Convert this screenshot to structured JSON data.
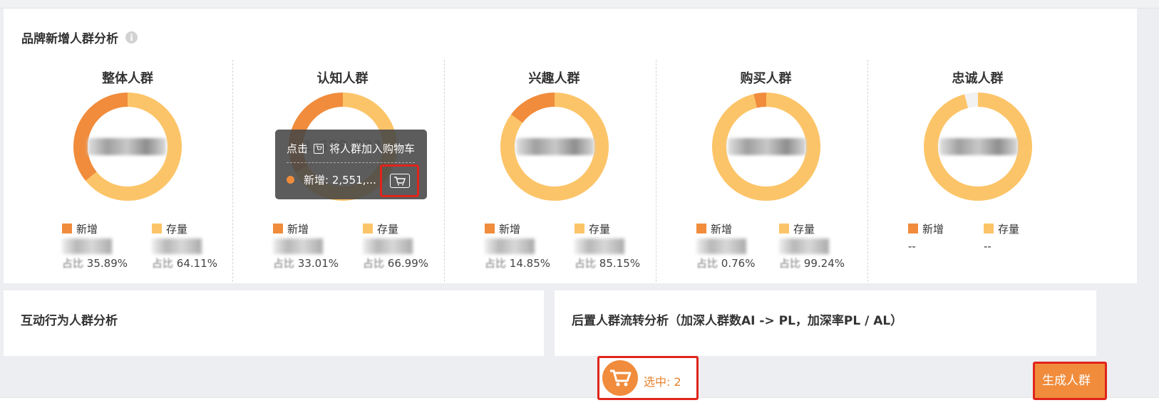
{
  "main_panel": {
    "title": "品牌新增人群分析",
    "info_icon": "info-icon"
  },
  "legend_labels": {
    "new": "新增",
    "stock": "存量",
    "pct_label": "占比"
  },
  "colors": {
    "new": "#f08c3c",
    "stock": "#fcc468",
    "gap": "#f2f2f2",
    "accent_red": "#e0241b"
  },
  "audiences": [
    {
      "title": "整体人群",
      "new_pct": "35.89%",
      "stock_pct": "64.11%",
      "new_fraction": 0.3589
    },
    {
      "title": "认知人群",
      "new_pct": "33.01%",
      "stock_pct": "66.99%",
      "new_fraction": 0.3301,
      "center_value": "1,628,321"
    },
    {
      "title": "兴趣人群",
      "new_pct": "14.85%",
      "stock_pct": "85.15%",
      "new_fraction": 0.1485
    },
    {
      "title": "购买人群",
      "new_pct": "0.76%",
      "stock_pct": "99.24%",
      "new_fraction": 0.0376
    },
    {
      "title": "忠诚人群",
      "new_value": "--",
      "stock_value": "--",
      "gap_fraction": 0.04
    }
  ],
  "tooltip": {
    "hint_prefix": "点击",
    "hint_suffix": "将人群加入购物车",
    "new_label": "新增: 2,551,...",
    "cart_icon": "cart-icon"
  },
  "panels": {
    "interaction_title": "互动行为人群分析",
    "flow_title": "后置人群流转分析（加深人群数AI -> PL，加深率PL / AL）"
  },
  "cart": {
    "selected_label": "选中: 2",
    "icon": "shopping-cart-icon"
  },
  "generate_button": "生成人群"
}
